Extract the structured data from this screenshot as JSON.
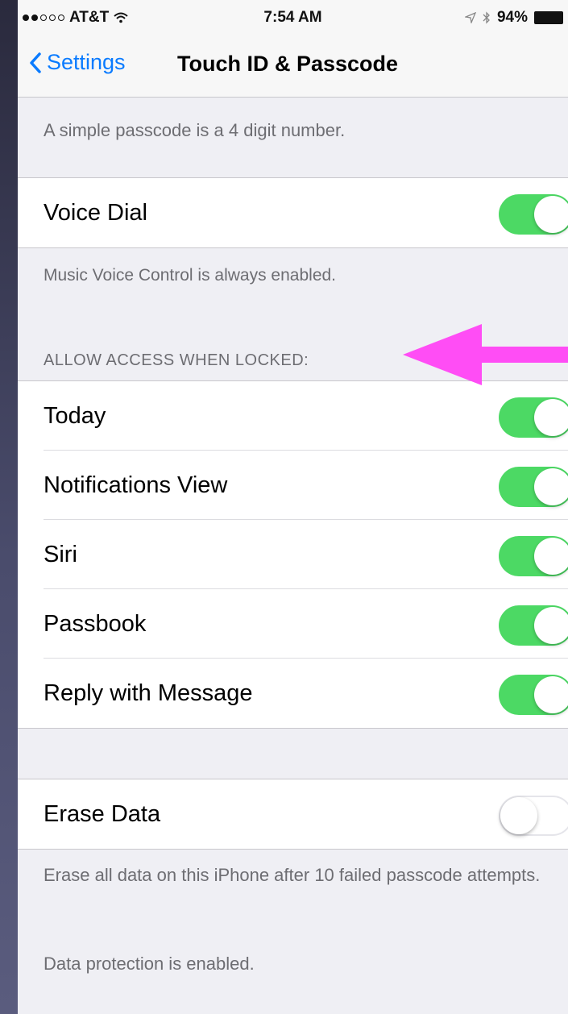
{
  "status_bar": {
    "carrier": "AT&T",
    "time": "7:54 AM",
    "battery": "94%",
    "signal_dots_filled": 2,
    "signal_dots_total": 5
  },
  "nav": {
    "back_label": "Settings",
    "title": "Touch ID & Passcode"
  },
  "notes": {
    "simple_passcode": "A simple passcode is a 4 digit number.",
    "music_voice": "Music Voice Control is always enabled.",
    "erase_footer": "Erase all data on this iPhone after 10 failed passcode attempts.",
    "data_protection": "Data protection is enabled."
  },
  "voice_dial": {
    "label": "Voice Dial",
    "on": true
  },
  "locked_section": {
    "header": "ALLOW ACCESS WHEN LOCKED:",
    "items": [
      {
        "label": "Today",
        "on": true
      },
      {
        "label": "Notifications View",
        "on": true
      },
      {
        "label": "Siri",
        "on": true
      },
      {
        "label": "Passbook",
        "on": true
      },
      {
        "label": "Reply with Message",
        "on": true
      }
    ]
  },
  "erase_data": {
    "label": "Erase Data",
    "on": false
  },
  "colors": {
    "accent": "#0a7bff",
    "toggle_on": "#4cd964",
    "annotation_arrow": "#ff4df5",
    "background": "#efeff4"
  },
  "icons": {
    "back": "chevron-left-icon",
    "wifi": "wifi-icon",
    "location": "location-arrow-icon",
    "bluetooth": "bluetooth-icon",
    "battery": "battery-icon"
  }
}
